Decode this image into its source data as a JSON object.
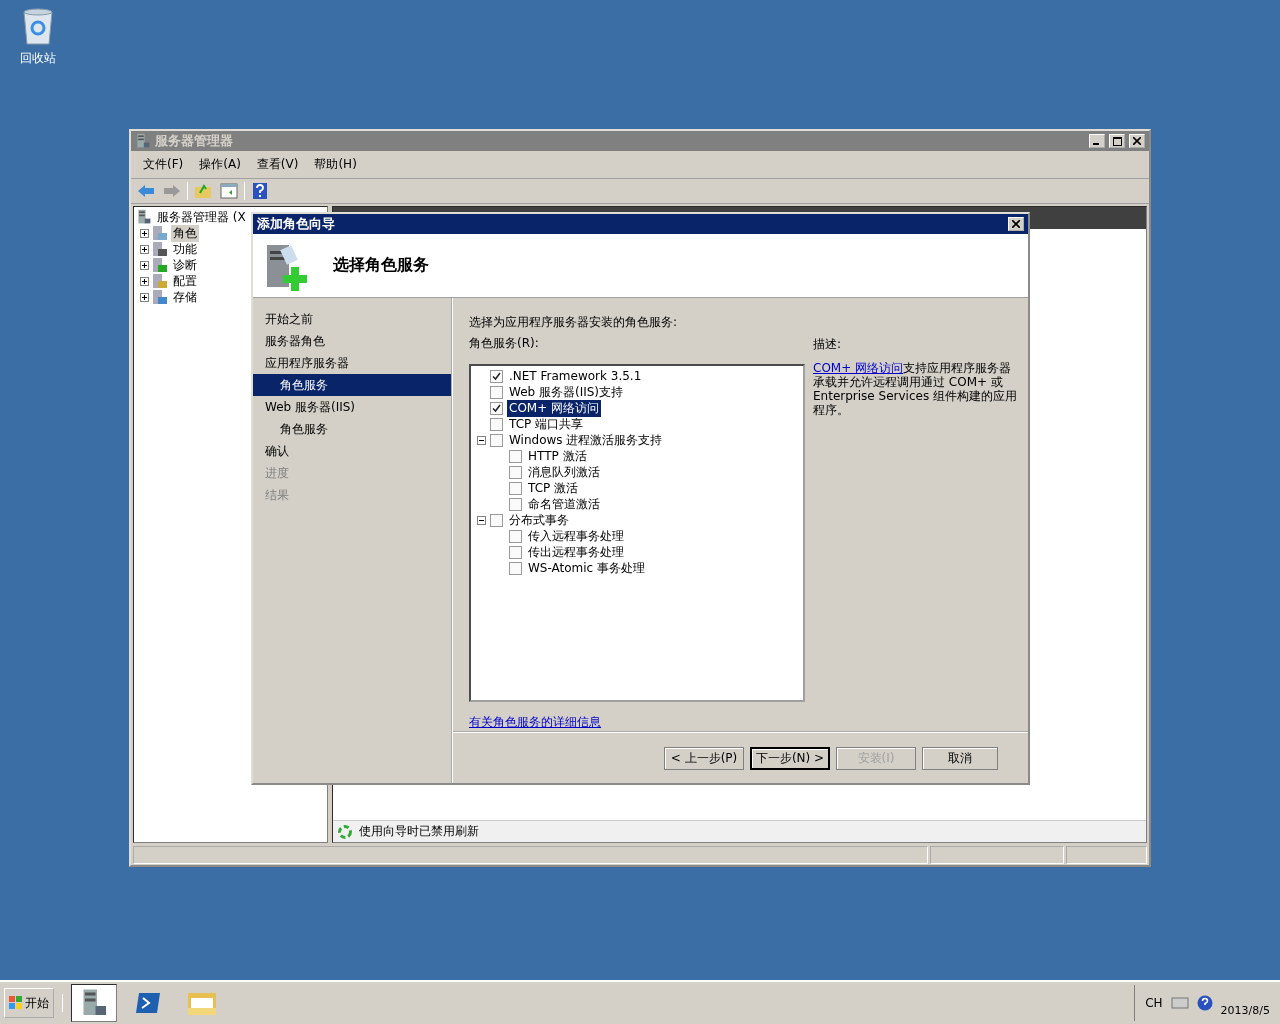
{
  "desktop_icons": [
    {
      "label": "回收站"
    }
  ],
  "server_manager": {
    "title": "服务器管理器",
    "menu": [
      "文件(F)",
      "操作(A)",
      "查看(V)",
      "帮助(H)"
    ],
    "tree_root": "服务器管理器 (X",
    "tree": [
      {
        "label": "角色",
        "selected": true,
        "expanded": false
      },
      {
        "label": "功能",
        "selected": false,
        "expanded": false
      },
      {
        "label": "诊断",
        "selected": false,
        "expanded": false
      },
      {
        "label": "配置",
        "selected": false,
        "expanded": false
      },
      {
        "label": "存储",
        "selected": false,
        "expanded": false
      }
    ],
    "status_text": "使用向导时已禁用刷新"
  },
  "wizard": {
    "title": "添加角色向导",
    "heading": "选择角色服务",
    "steps": [
      {
        "label": "开始之前",
        "selected": false,
        "disabled": false
      },
      {
        "label": "服务器角色",
        "selected": false,
        "disabled": false
      },
      {
        "label": "应用程序服务器",
        "selected": false,
        "disabled": false,
        "children": [
          {
            "label": "角色服务",
            "selected": true,
            "disabled": false
          }
        ]
      },
      {
        "label": "Web 服务器(IIS)",
        "selected": false,
        "disabled": false,
        "children": [
          {
            "label": "角色服务",
            "selected": false,
            "disabled": false
          }
        ]
      },
      {
        "label": "确认",
        "selected": false,
        "disabled": false
      },
      {
        "label": "进度",
        "selected": false,
        "disabled": true
      },
      {
        "label": "结果",
        "selected": false,
        "disabled": true
      }
    ],
    "prompt": "选择为应用程序服务器安装的角色服务:",
    "list_label": "角色服务(R):",
    "role_services": [
      {
        "label": ".NET Framework 3.5.1",
        "checked": true,
        "selected": false
      },
      {
        "label": "Web 服务器(IIS)支持",
        "checked": false,
        "selected": false
      },
      {
        "label": "COM+ 网络访问",
        "checked": true,
        "selected": true
      },
      {
        "label": "TCP 端口共享",
        "checked": false,
        "selected": false
      },
      {
        "label": "Windows 进程激活服务支持",
        "checked": false,
        "selected": false,
        "expanded": true,
        "children": [
          {
            "label": "HTTP 激活",
            "checked": false,
            "selected": false
          },
          {
            "label": "消息队列激活",
            "checked": false,
            "selected": false
          },
          {
            "label": "TCP 激活",
            "checked": false,
            "selected": false
          },
          {
            "label": "命名管道激活",
            "checked": false,
            "selected": false
          }
        ]
      },
      {
        "label": "分布式事务",
        "checked": false,
        "selected": false,
        "expanded": true,
        "children": [
          {
            "label": "传入远程事务处理",
            "checked": false,
            "selected": false
          },
          {
            "label": "传出远程事务处理",
            "checked": false,
            "selected": false
          },
          {
            "label": "WS-Atomic 事务处理",
            "checked": false,
            "selected": false
          }
        ]
      }
    ],
    "description_label": "描述:",
    "description": {
      "link": "COM+ 网络访问",
      "text": "支持应用程序服务器承载并允许远程调用通过 COM+ 或 Enterprise Services 组件构建的应用程序。"
    },
    "more_info_link": "有关角色服务的详细信息",
    "buttons": [
      {
        "label": "< 上一步(P)",
        "disabled": false,
        "default": false
      },
      {
        "label": "下一步(N) >",
        "disabled": false,
        "default": true
      },
      {
        "label": "安装(I)",
        "disabled": true,
        "default": false
      },
      {
        "label": "取消",
        "disabled": false,
        "default": false
      }
    ]
  },
  "taskbar": {
    "start": "开始",
    "language": "CH",
    "date": "2013/8/5"
  }
}
